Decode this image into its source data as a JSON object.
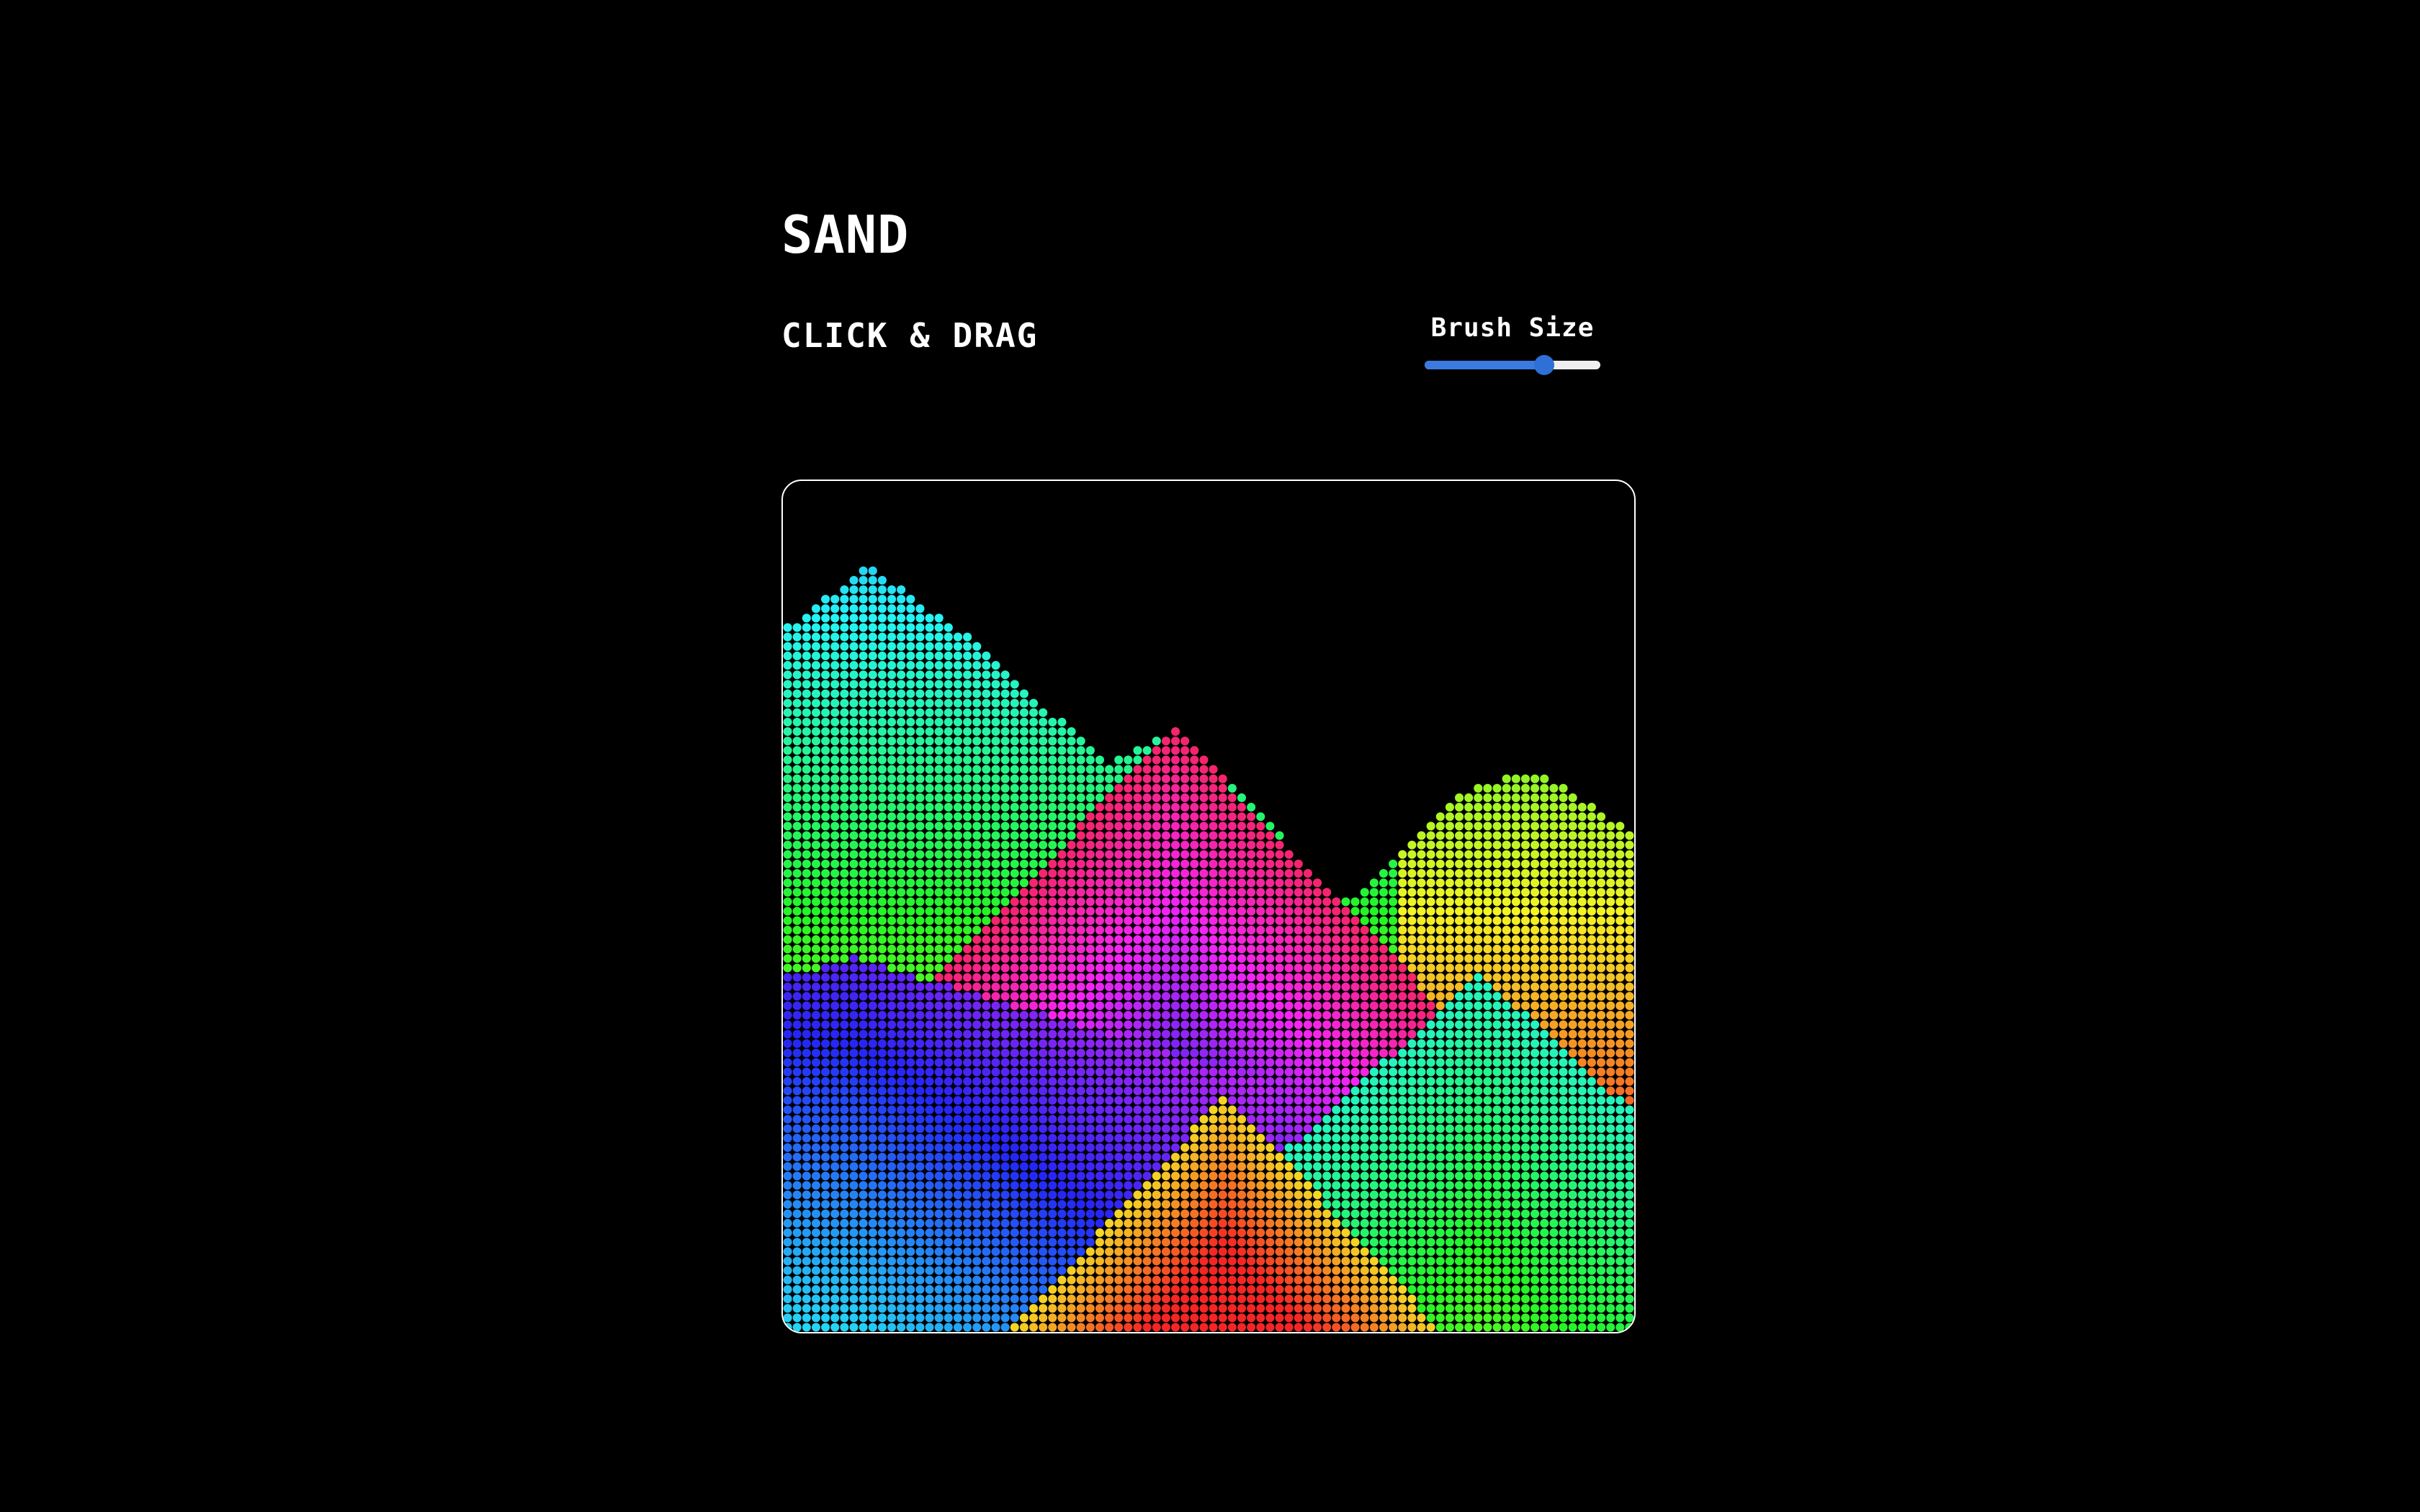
{
  "header": {
    "title": "SAND",
    "subtitle": "CLICK & DRAG"
  },
  "brush": {
    "label": "Brush Size",
    "value_fraction": 0.68
  },
  "colors": {
    "background": "#000000",
    "frame_border": "#ffffff",
    "slider_fill": "#3b7be0",
    "slider_track": "#efefef"
  }
}
